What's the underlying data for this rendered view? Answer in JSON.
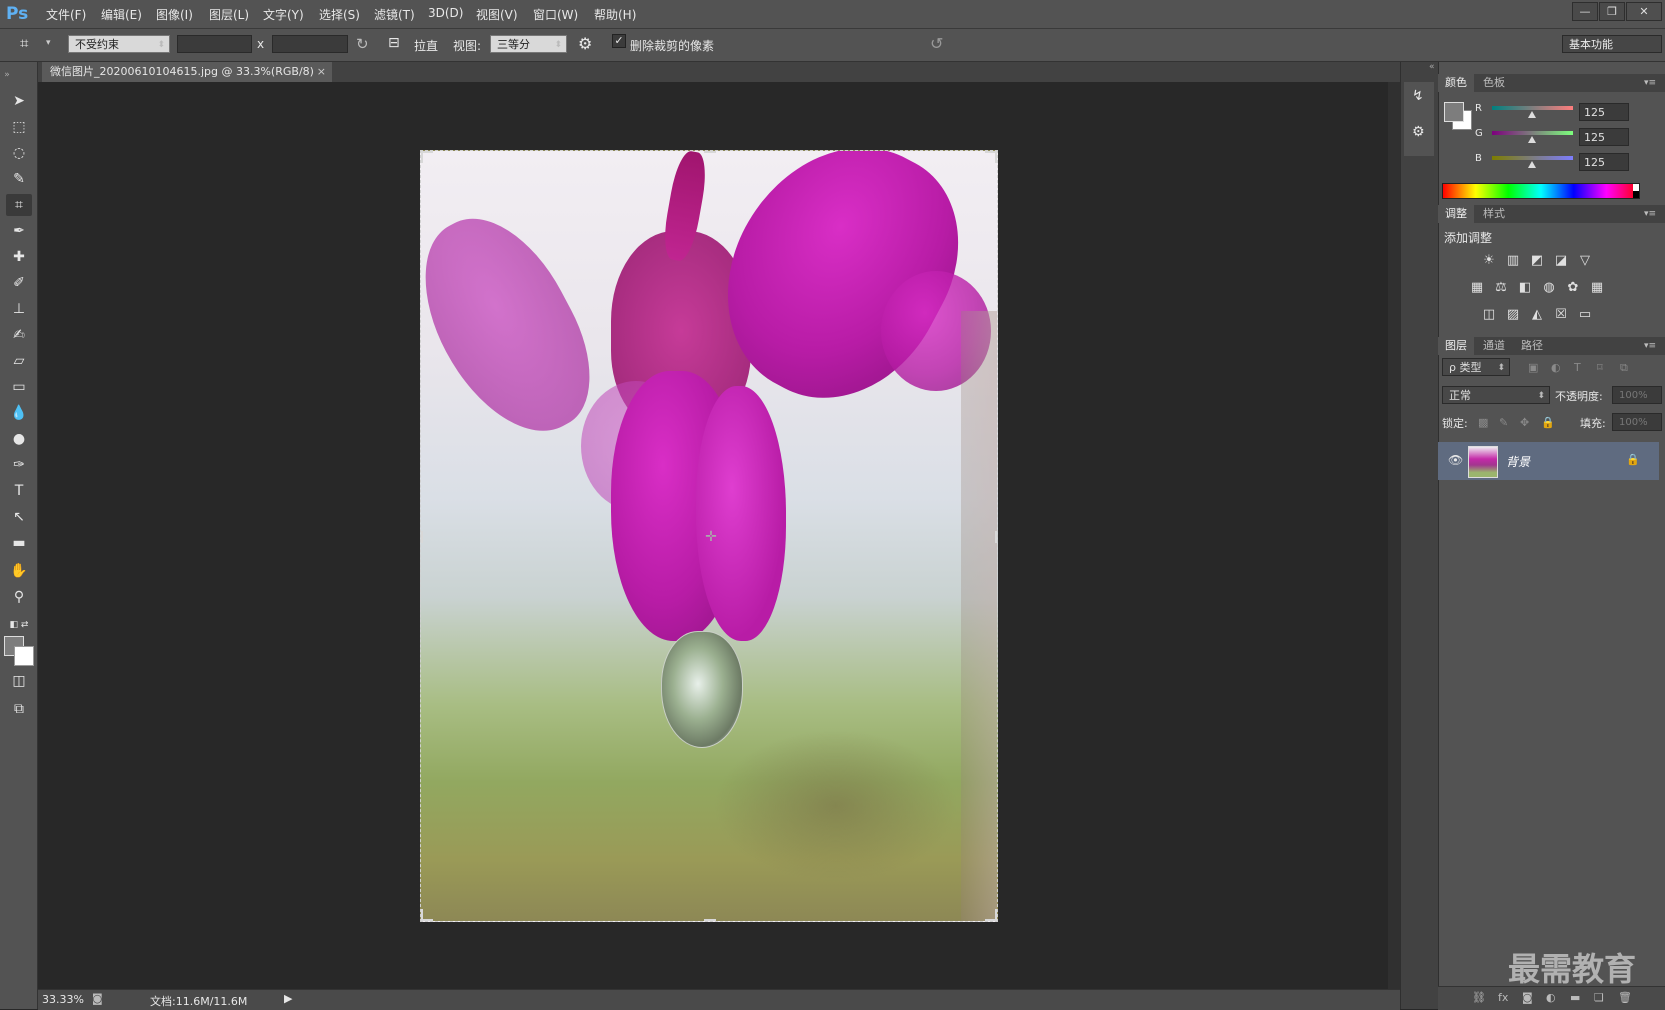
{
  "app": {
    "logo": "Ps"
  },
  "menu": [
    {
      "label": "文件(F)"
    },
    {
      "label": "编辑(E)"
    },
    {
      "label": "图像(I)"
    },
    {
      "label": "图层(L)"
    },
    {
      "label": "文字(Y)"
    },
    {
      "label": "选择(S)"
    },
    {
      "label": "滤镜(T)"
    },
    {
      "label": "3D(D)"
    },
    {
      "label": "视图(V)"
    },
    {
      "label": "窗口(W)"
    },
    {
      "label": "帮助(H)"
    }
  ],
  "window_controls": {
    "minimize": "—",
    "restore": "❐",
    "close": "✕"
  },
  "options": {
    "ratio_select": "不受约束",
    "width_value": "",
    "times": "x",
    "height_value": "",
    "straighten_label": "拉直",
    "view_label": "视图:",
    "view_select": "三等分",
    "delete_cropped_label": "删除裁剪的像素",
    "delete_cropped_checked": true,
    "workspace": "基本功能"
  },
  "document": {
    "tab_title": "微信图片_20200610104615.jpg @ 33.3%(RGB/8)",
    "tab_close": "×",
    "zoom": "33.33%",
    "doc_info": "文档:11.6M/11.6M"
  },
  "color_panel": {
    "tabs": [
      "颜色",
      "色板"
    ],
    "channels": [
      {
        "label": "R",
        "value": "125",
        "fraction": 0.49,
        "gradient": "linear-gradient(90deg,#00807f,#ff7d7d)"
      },
      {
        "label": "G",
        "value": "125",
        "fraction": 0.49,
        "gradient": "linear-gradient(90deg,#7d007d,#7dff7d)"
      },
      {
        "label": "B",
        "value": "125",
        "fraction": 0.49,
        "gradient": "linear-gradient(90deg,#7d7d00,#7d7dff)"
      }
    ],
    "fg_color": "#7d7d7d",
    "bg_color": "#ffffff"
  },
  "adjust_panel": {
    "tabs": [
      "调整",
      "样式"
    ],
    "title": "添加调整"
  },
  "layers_panel": {
    "tabs": [
      "图层",
      "通道",
      "路径"
    ],
    "filter_select": "ρ 类型",
    "blend_mode": "正常",
    "opacity_label": "不透明度:",
    "opacity_value": "100%",
    "lock_label": "锁定:",
    "fill_label": "填充:",
    "fill_value": "100%",
    "layers": [
      {
        "name": "背景",
        "visible": true,
        "locked": true
      }
    ]
  },
  "watermark": "最需教育"
}
